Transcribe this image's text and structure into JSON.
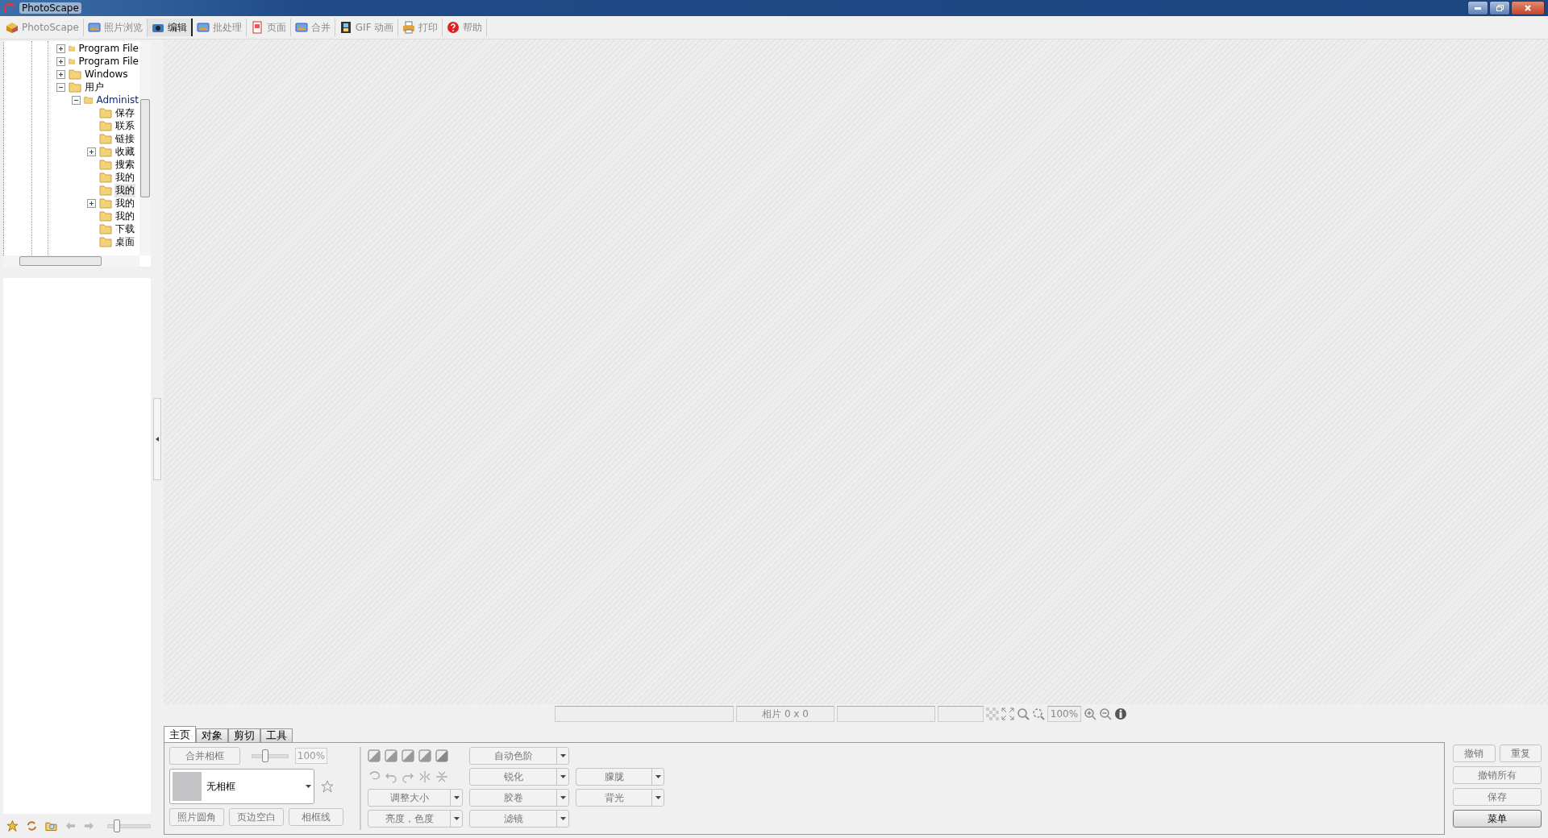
{
  "window": {
    "title": "PhotoScape"
  },
  "toolbar": [
    {
      "label": "PhotoScape",
      "selected": false
    },
    {
      "label": "照片浏览",
      "selected": false
    },
    {
      "label": "编辑",
      "selected": true
    },
    {
      "label": "批处理",
      "selected": false
    },
    {
      "label": "页面",
      "selected": false
    },
    {
      "label": "合并",
      "selected": false
    },
    {
      "label": "GIF 动画",
      "selected": false
    },
    {
      "label": "打印",
      "selected": false
    },
    {
      "label": "帮助",
      "selected": false
    }
  ],
  "tree": [
    {
      "label": "Program File",
      "kind": "branch",
      "expanded": false,
      "selected": false
    },
    {
      "label": "Program File",
      "kind": "branch",
      "expanded": false,
      "selected": false
    },
    {
      "label": "Windows",
      "kind": "branch",
      "expanded": false,
      "selected": false
    },
    {
      "label": "用户",
      "kind": "branch",
      "expanded": true,
      "selected": false,
      "children": [
        {
          "label": "Administ",
          "kind": "branch",
          "expanded": true,
          "selected": false,
          "children": [
            {
              "label": "保存",
              "kind": "leaf",
              "selected": false
            },
            {
              "label": "联系",
              "kind": "leaf",
              "selected": false
            },
            {
              "label": "链接",
              "kind": "leaf",
              "selected": false
            },
            {
              "label": "收藏",
              "kind": "branch",
              "expanded": false,
              "selected": false
            },
            {
              "label": "搜索",
              "kind": "leaf",
              "selected": false
            },
            {
              "label": "我的",
              "kind": "leaf",
              "selected": false
            },
            {
              "label": "我的",
              "kind": "leaf",
              "selected": true
            },
            {
              "label": "我的",
              "kind": "branch",
              "expanded": false,
              "selected": false
            },
            {
              "label": "我的",
              "kind": "leaf",
              "selected": false
            },
            {
              "label": "下载",
              "kind": "leaf",
              "selected": false
            },
            {
              "label": "桌面",
              "kind": "leaf",
              "selected": false
            }
          ]
        }
      ]
    }
  ],
  "thumb_size_slider": {
    "level": 0.2
  },
  "status_bar": {
    "photo_size": "相片 0 x 0",
    "zoom": "100%"
  },
  "bottom_panel": {
    "tabs": [
      {
        "label": "主页",
        "selected": true
      },
      {
        "label": "对象",
        "selected": false
      },
      {
        "label": "剪切",
        "selected": false
      },
      {
        "label": "工具",
        "selected": false
      }
    ],
    "merge_frame_button": {
      "label": "合并相框",
      "disabled": true
    },
    "frame_opacity": {
      "level": 0.35,
      "value": "100%"
    },
    "frame_select": {
      "value": "无相框"
    },
    "frame_buttons": [
      {
        "label": "照片圆角",
        "disabled": true
      },
      {
        "label": "页边空白",
        "disabled": true
      },
      {
        "label": "相框线",
        "disabled": true
      }
    ],
    "tool_columns": [
      [
        {
          "label": "调整大小",
          "disabled": true
        },
        {
          "label": "亮度，色度",
          "disabled": true
        }
      ],
      [
        {
          "label": "自动色阶",
          "disabled": true
        },
        {
          "label": "锐化",
          "disabled": true
        },
        {
          "label": "胶卷",
          "disabled": true
        },
        {
          "label": "滤镜",
          "disabled": true
        }
      ],
      [
        {
          "label": "朦胧",
          "disabled": true
        },
        {
          "label": "背光",
          "disabled": true
        }
      ]
    ],
    "action_buttons": [
      {
        "label": "撤销",
        "disabled": true
      },
      {
        "label": "重复",
        "disabled": true
      },
      {
        "label": "撤销所有",
        "disabled": true
      },
      {
        "label": "保存",
        "disabled": true
      },
      {
        "label": "菜单",
        "disabled": false
      }
    ]
  }
}
